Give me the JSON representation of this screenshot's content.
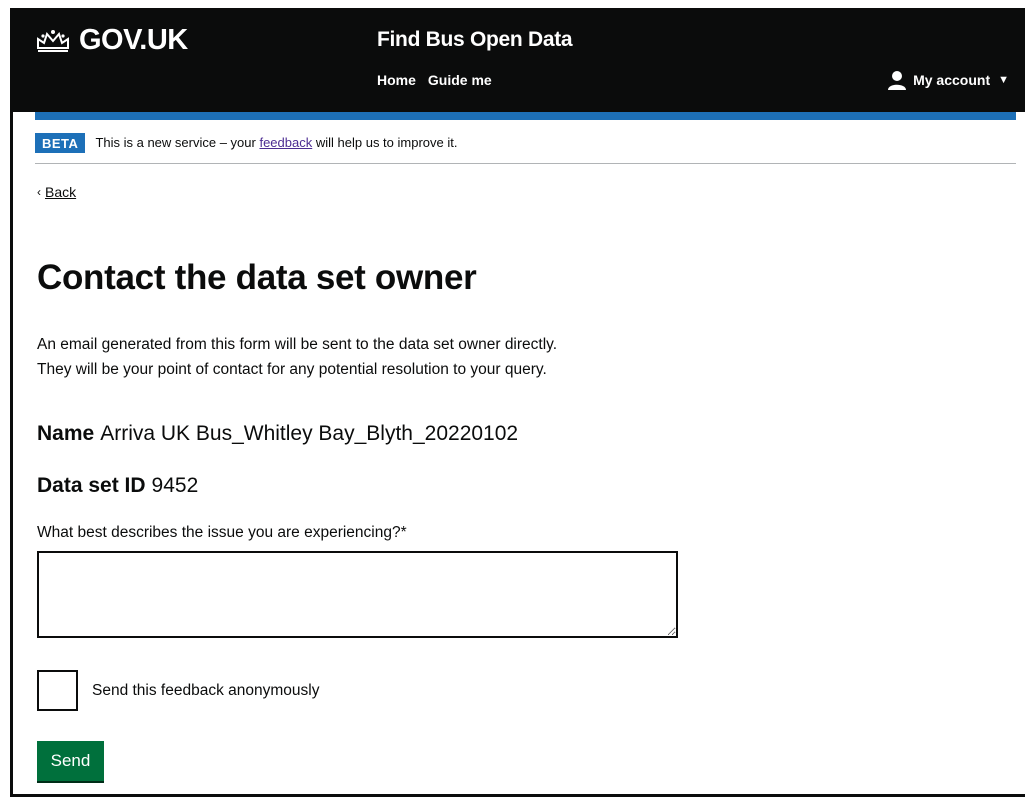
{
  "header": {
    "logo_text": "GOV.UK",
    "logo_icon": "crown-icon",
    "service_name": "Find Bus Open Data",
    "nav": [
      {
        "label": "Home"
      },
      {
        "label": "Guide me"
      }
    ],
    "account_label": "My account",
    "account_icon": "user-icon",
    "header_color": "#0b0c0c",
    "accent_color": "#1d70b8"
  },
  "beta_banner": {
    "tag": "BETA",
    "text_before": "This is a new service – your",
    "link": "feedback",
    "text_after": "will help us to improve it."
  },
  "back_link": "Back",
  "main": {
    "title": "Contact the data set owner",
    "lead_line1": "An email generated from this form will be sent to the data set owner directly.",
    "lead_line2": "They will be your point of contact for any potential resolution to your query.",
    "name_key": "Name",
    "name_value": "Arriva UK Bus_Whitley Bay_Blyth_20220102",
    "id_key": "Data set ID",
    "id_value": "9452",
    "field_label": "What best describes the issue you are experiencing?*",
    "textarea_value": "",
    "checkbox_label": "Send this feedback anonymously",
    "checkbox_checked": false,
    "send_label": "Send",
    "button_color": "#00703c"
  }
}
